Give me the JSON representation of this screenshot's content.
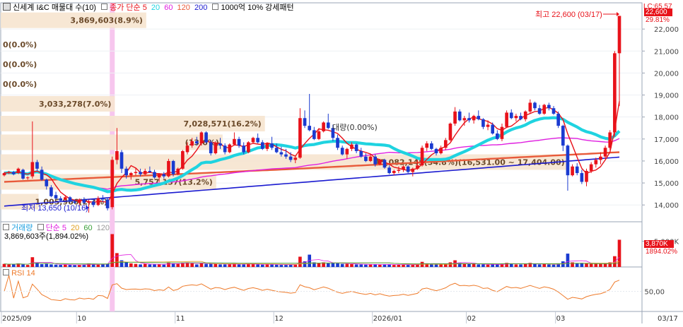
{
  "header": {
    "stock_name": "신세계 I&C 매물대 수(10)",
    "ma_label": "종가 단순",
    "ma_periods": [
      "5",
      "20",
      "60",
      "120",
      "200"
    ],
    "ma_colors": [
      "#e8121a",
      "#1fd3e0",
      "#e020e0",
      "#e85a3a",
      "#1a1ad0"
    ],
    "extra": "1000억 10% 강세패턴",
    "corner_label": "LC:65.57",
    "price_tag": "22,600",
    "price_tag_pct": "29.81%"
  },
  "volume_header": {
    "title": "거래량",
    "ma_label": "단순",
    "ma_periods": [
      "5",
      "20",
      "60",
      "120"
    ],
    "ma_colors": [
      "#e020e0",
      "#e0a020",
      "#3aa03a",
      "#999999"
    ],
    "current": "3,869,603주(1,894.02%)",
    "tag_value": "3,870K",
    "tag_pct": "1894.02%"
  },
  "rsi_header": {
    "title": "RSI 14"
  },
  "annotations": {
    "high": "최고 22,600 (03/17)",
    "low": "최저 13,650 (10/16)",
    "current_bar_line": "대량(0.00%)"
  },
  "volume_profile": [
    {
      "label": "3,869,603(8.9%)",
      "price": 22400,
      "fraction": 0.227
    },
    {
      "label": "0(0.0%)",
      "price": 21300,
      "fraction": 0
    },
    {
      "label": "0(0.0%)",
      "price": 20400,
      "fraction": 0
    },
    {
      "label": "0(0.0%)",
      "price": 19500,
      "fraction": 0
    },
    {
      "label": "3,033,278(7.0%)",
      "price": 18600,
      "fraction": 0.178
    },
    {
      "label": "7,028,571(16.2%)",
      "price": 17700,
      "fraction": 0.412
    },
    {
      "label": "(13.6%)",
      "price": 16850,
      "fraction": 0.346
    },
    {
      "label": "15,082,145(34.8%)(16,531.00 ~ 17,404.00)",
      "price": 15950,
      "fraction": 0.885
    },
    {
      "label": "5,757,137(13.2%)",
      "price": 15050,
      "fraction": 0.336
    },
    {
      "label": "1,005,966(2.3%)",
      "price": 14150,
      "fraction": 0.059
    }
  ],
  "chart_data": {
    "type": "candlestick",
    "title": "신세계 I&C",
    "price_axis": {
      "ylim": [
        13300,
        23000
      ],
      "ticks": [
        14000,
        15000,
        16000,
        17000,
        18000,
        19000,
        20000,
        21000,
        22000
      ]
    },
    "volume_axis": {
      "ticks": [
        {
          "label": "5,000K",
          "value": 5000
        }
      ]
    },
    "rsi_axis": {
      "ticks": [
        {
          "label": "50,00",
          "value": 50
        }
      ]
    },
    "x_axis_labels": [
      "2025/09",
      "10",
      "11",
      "12",
      "2026/01",
      "02",
      "03",
      "03/17"
    ],
    "x_axis_label_positions": [
      0,
      16,
      37,
      58,
      79,
      99,
      118,
      132
    ],
    "highlight_index": 23,
    "candles": [
      [
        15350,
        15500,
        15300,
        15450
      ],
      [
        15450,
        15550,
        15400,
        15500
      ],
      [
        15500,
        15550,
        15350,
        15400
      ],
      [
        15450,
        15700,
        15400,
        15650
      ],
      [
        15600,
        15650,
        15150,
        15200
      ],
      [
        15250,
        15300,
        15150,
        15250
      ],
      [
        15300,
        17800,
        15200,
        15950
      ],
      [
        15950,
        16050,
        15550,
        15650
      ],
      [
        15600,
        15750,
        15100,
        15150
      ],
      [
        15150,
        15200,
        14700,
        14850
      ],
      [
        14800,
        14900,
        14350,
        14400
      ],
      [
        14450,
        14600,
        14250,
        14300
      ],
      [
        14300,
        14400,
        14150,
        14200
      ],
      [
        14250,
        14450,
        14200,
        14350
      ],
      [
        14350,
        14400,
        14100,
        14150
      ],
      [
        14150,
        14250,
        14050,
        14100
      ],
      [
        14100,
        14300,
        13950,
        14250
      ],
      [
        14250,
        14350,
        14050,
        14100
      ],
      [
        14100,
        14250,
        13650,
        14150
      ],
      [
        14150,
        14250,
        13900,
        14000
      ],
      [
        14000,
        14400,
        13950,
        14300
      ],
      [
        14300,
        14450,
        14150,
        14250
      ],
      [
        14250,
        14300,
        13750,
        13850
      ],
      [
        13900,
        16200,
        13800,
        16050
      ],
      [
        16050,
        17500,
        15850,
        16450
      ],
      [
        16400,
        16500,
        15450,
        15650
      ],
      [
        15650,
        15750,
        15200,
        15350
      ],
      [
        15350,
        15500,
        15150,
        15450
      ],
      [
        15450,
        15700,
        15350,
        15500
      ],
      [
        15500,
        15650,
        15300,
        15400
      ],
      [
        15400,
        15650,
        15350,
        15550
      ],
      [
        15550,
        15750,
        15450,
        15500
      ],
      [
        15500,
        15600,
        15200,
        15250
      ],
      [
        15250,
        15450,
        15050,
        15400
      ],
      [
        15400,
        15500,
        15200,
        15300
      ],
      [
        15300,
        16100,
        15250,
        16000
      ],
      [
        16000,
        16050,
        15300,
        15400
      ],
      [
        15400,
        15700,
        15350,
        15650
      ],
      [
        15650,
        16500,
        15600,
        16450
      ],
      [
        16400,
        16850,
        16300,
        16700
      ],
      [
        16700,
        17050,
        16600,
        16900
      ],
      [
        16900,
        17100,
        16700,
        16800
      ],
      [
        16800,
        17350,
        16700,
        17300
      ],
      [
        17300,
        17350,
        16800,
        16850
      ],
      [
        16850,
        16950,
        16250,
        16350
      ],
      [
        16350,
        16900,
        16300,
        16800
      ],
      [
        16800,
        17050,
        16550,
        16700
      ],
      [
        16700,
        16800,
        16300,
        16400
      ],
      [
        16400,
        16800,
        16350,
        16750
      ],
      [
        16750,
        17300,
        16700,
        17000
      ],
      [
        17000,
        17100,
        16600,
        16700
      ],
      [
        16700,
        16850,
        16300,
        16400
      ],
      [
        16400,
        16900,
        16350,
        16850
      ],
      [
        16850,
        17100,
        16800,
        17050
      ],
      [
        17050,
        17250,
        16800,
        16850
      ],
      [
        16850,
        16950,
        16500,
        16550
      ],
      [
        16550,
        16850,
        16450,
        16800
      ],
      [
        16800,
        17100,
        16500,
        16600
      ],
      [
        16600,
        16800,
        16350,
        16400
      ],
      [
        16400,
        16650,
        16200,
        16300
      ],
      [
        16300,
        16550,
        16100,
        16200
      ],
      [
        16200,
        16400,
        15950,
        16050
      ],
      [
        16050,
        16250,
        15900,
        16150
      ],
      [
        16150,
        18400,
        16100,
        17950
      ],
      [
        17950,
        18300,
        17500,
        17600
      ],
      [
        17600,
        19050,
        17350,
        17400
      ],
      [
        17400,
        17550,
        16950,
        17000
      ],
      [
        17000,
        17500,
        16950,
        17350
      ],
      [
        17350,
        17800,
        17300,
        17750
      ],
      [
        17750,
        18150,
        17450,
        17500
      ],
      [
        17500,
        17650,
        16900,
        17050
      ],
      [
        17050,
        17200,
        16500,
        16600
      ],
      [
        16600,
        16700,
        16250,
        16300
      ],
      [
        16300,
        16600,
        16100,
        16550
      ],
      [
        16550,
        16850,
        16450,
        16750
      ],
      [
        16750,
        16800,
        16350,
        16450
      ],
      [
        16450,
        16600,
        16150,
        16200
      ],
      [
        16200,
        16350,
        15950,
        16000
      ],
      [
        16000,
        16300,
        15950,
        16200
      ],
      [
        16200,
        16300,
        15750,
        15850
      ],
      [
        15850,
        16100,
        15800,
        16050
      ],
      [
        16050,
        16100,
        15650,
        15700
      ],
      [
        15700,
        15800,
        15400,
        15450
      ],
      [
        15450,
        15600,
        15350,
        15550
      ],
      [
        15550,
        15750,
        15450,
        15600
      ],
      [
        15600,
        15800,
        15500,
        15750
      ],
      [
        15750,
        15800,
        15450,
        15500
      ],
      [
        15500,
        15700,
        15300,
        15650
      ],
      [
        15650,
        16050,
        15600,
        15800
      ],
      [
        15800,
        16700,
        15750,
        16600
      ],
      [
        16600,
        16900,
        16450,
        16800
      ],
      [
        16800,
        16900,
        16500,
        16550
      ],
      [
        16550,
        16600,
        16250,
        16350
      ],
      [
        16350,
        16700,
        16300,
        16600
      ],
      [
        16600,
        17050,
        16500,
        16950
      ],
      [
        16950,
        17750,
        16900,
        17700
      ],
      [
        17700,
        18450,
        17600,
        18250
      ],
      [
        18250,
        18350,
        17800,
        17850
      ],
      [
        17850,
        18050,
        17600,
        17950
      ],
      [
        17950,
        18200,
        17750,
        17850
      ],
      [
        17850,
        18100,
        17700,
        18050
      ],
      [
        18050,
        18300,
        17850,
        17900
      ],
      [
        17900,
        17950,
        17450,
        17550
      ],
      [
        17550,
        17850,
        17400,
        17650
      ],
      [
        17650,
        17750,
        17200,
        17250
      ],
      [
        17250,
        17400,
        16950,
        17000
      ],
      [
        17000,
        17700,
        16900,
        17550
      ],
      [
        17550,
        18300,
        17500,
        18200
      ],
      [
        18200,
        18350,
        17900,
        17950
      ],
      [
        17950,
        18150,
        17800,
        18050
      ],
      [
        18050,
        18200,
        17850,
        17900
      ],
      [
        17900,
        18300,
        17800,
        18250
      ],
      [
        18250,
        18800,
        18150,
        18650
      ],
      [
        18650,
        18700,
        18300,
        18400
      ],
      [
        18400,
        18550,
        18100,
        18150
      ],
      [
        18150,
        18600,
        18100,
        18550
      ],
      [
        18550,
        18650,
        18300,
        18400
      ],
      [
        18400,
        18500,
        18100,
        18150
      ],
      [
        18150,
        18250,
        17500,
        17600
      ],
      [
        17600,
        17650,
        16450,
        16700
      ],
      [
        16700,
        16750,
        14650,
        15350
      ],
      [
        15350,
        15850,
        15300,
        15750
      ],
      [
        15750,
        15900,
        15350,
        15450
      ],
      [
        15450,
        15600,
        14950,
        15050
      ],
      [
        15050,
        15650,
        14850,
        15550
      ],
      [
        15550,
        15950,
        15450,
        15850
      ],
      [
        15850,
        16150,
        15700,
        16050
      ],
      [
        16050,
        16400,
        15850,
        16200
      ],
      [
        16200,
        16700,
        16100,
        16600
      ],
      [
        16600,
        17400,
        16500,
        17300
      ],
      [
        17300,
        21000,
        17100,
        20900
      ],
      [
        20900,
        22600,
        18500,
        22600
      ]
    ],
    "volume": [
      0.6,
      0.5,
      0.55,
      0.7,
      0.5,
      0.4,
      1.9,
      0.9,
      0.55,
      0.6,
      0.5,
      0.45,
      0.4,
      0.45,
      0.4,
      0.35,
      0.4,
      0.45,
      0.7,
      0.5,
      0.45,
      0.5,
      0.6,
      6.4,
      2.7,
      1.3,
      0.9,
      0.7,
      0.6,
      0.5,
      0.6,
      0.5,
      0.5,
      0.55,
      0.45,
      0.9,
      0.7,
      0.6,
      0.8,
      0.9,
      0.7,
      0.5,
      0.8,
      0.6,
      0.6,
      0.6,
      0.5,
      0.5,
      0.55,
      0.7,
      0.5,
      0.5,
      0.6,
      0.55,
      0.5,
      0.45,
      0.5,
      0.55,
      0.45,
      0.4,
      0.4,
      0.5,
      0.45,
      2.0,
      1.1,
      2.4,
      0.9,
      0.8,
      0.9,
      0.7,
      0.8,
      0.7,
      0.6,
      0.6,
      0.55,
      0.5,
      0.5,
      0.45,
      0.5,
      0.5,
      0.45,
      0.5,
      0.55,
      0.4,
      0.45,
      0.45,
      0.4,
      0.45,
      0.5,
      1.0,
      0.7,
      0.55,
      0.5,
      0.5,
      0.6,
      0.9,
      1.3,
      0.8,
      0.6,
      0.55,
      0.6,
      0.5,
      0.5,
      0.45,
      0.5,
      0.5,
      0.6,
      0.8,
      0.6,
      0.5,
      0.5,
      0.55,
      0.8,
      0.6,
      0.5,
      0.55,
      0.5,
      0.45,
      0.7,
      1.1,
      2.6,
      0.9,
      0.7,
      0.8,
      0.7,
      0.6,
      0.6,
      0.6,
      0.7,
      0.9,
      2.1,
      5.3
    ]
  }
}
